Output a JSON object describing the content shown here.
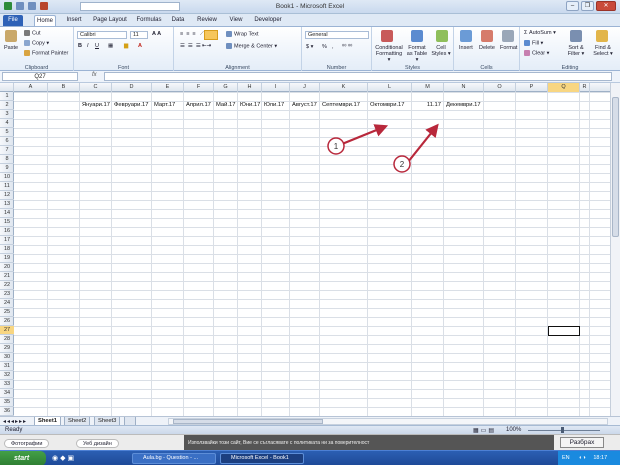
{
  "app": {
    "title": "Book1 - Microsoft Excel",
    "window_controls": [
      "–",
      "❐",
      "✕"
    ]
  },
  "tabs": [
    "File",
    "Home",
    "Insert",
    "Page Layout",
    "Formulas",
    "Data",
    "Review",
    "View",
    "Developer"
  ],
  "ribbon": {
    "clipboard": {
      "paste": "Paste",
      "cut": "Cut",
      "copy": "Copy ▾",
      "format_painter": "Format Painter",
      "label": "Clipboard"
    },
    "font": {
      "name": "Calibri",
      "size": "11",
      "label": "Font"
    },
    "alignment": {
      "wrap": "Wrap Text",
      "merge": "Merge & Center ▾",
      "label": "Alignment"
    },
    "number": {
      "format": "General",
      "label": "Number",
      "currency": "$ ▾",
      "percent": "%",
      "comma": ","
    },
    "styles": {
      "cond": "Conditional Formatting ▾",
      "table": "Format as Table ▾",
      "cell": "Cell Styles ▾",
      "label": "Styles"
    },
    "cells": {
      "insert": "Insert",
      "delete": "Delete",
      "format": "Format",
      "label": "Cells"
    },
    "editing": {
      "autosum": "AutoSum ▾",
      "fill": "Fill ▾",
      "clear": "Clear ▾",
      "sort": "Sort & Filter ▾",
      "find": "Find & Select ▾",
      "label": "Editing"
    }
  },
  "formula_bar": {
    "name_box": "Q27",
    "fx": "fx",
    "value": ""
  },
  "columns": [
    "A",
    "B",
    "C",
    "D",
    "E",
    "F",
    "G",
    "H",
    "I",
    "J",
    "K",
    "L",
    "M",
    "N",
    "O",
    "P",
    "Q",
    "R"
  ],
  "selected_cell": {
    "column": "Q",
    "row": 27
  },
  "cells": [
    {
      "col": "C",
      "text": "Януари.17"
    },
    {
      "col": "D",
      "text": "Февруари.17"
    },
    {
      "col": "E",
      "text": "Март.17"
    },
    {
      "col": "F",
      "text": "Април.17"
    },
    {
      "col": "G",
      "text": "Май.17"
    },
    {
      "col": "H",
      "text": "Юни.17"
    },
    {
      "col": "I",
      "text": "Юли.17"
    },
    {
      "col": "J",
      "text": "Август.17"
    },
    {
      "col": "K",
      "text": "Септември.17"
    },
    {
      "col": "L",
      "text": "Октомври.17"
    },
    {
      "col": "M",
      "text": "11.17"
    },
    {
      "col": "N",
      "text": "Декември.17"
    }
  ],
  "annotations": [
    {
      "label": "1"
    },
    {
      "label": "2"
    }
  ],
  "sheets": [
    "Sheet1",
    "Sheet2",
    "Sheet3"
  ],
  "status": {
    "ready": "Ready",
    "zoom": "100%"
  },
  "notification": {
    "text": "Използвайки този сайт, Вие се съгласявате с политиката ни за поверителност",
    "button": "Разбрах",
    "chips": [
      "Фотографии",
      "Уеб дизайн"
    ]
  },
  "taskbar": {
    "start": "start",
    "items": [
      "Aula.bg - Question - ...",
      "Microsoft Excel - Book1"
    ],
    "lang": "EN",
    "time": "18:17"
  }
}
